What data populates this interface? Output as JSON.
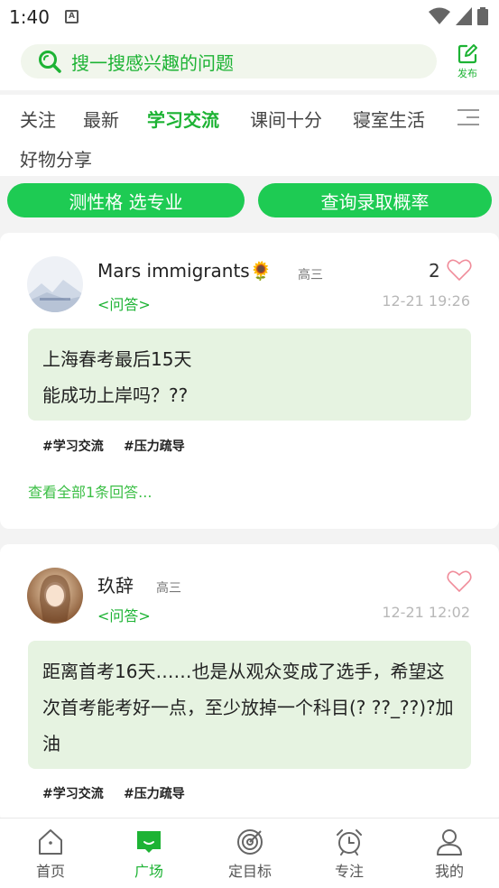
{
  "status_bar": {
    "time": "1:40",
    "notif_letter": "A"
  },
  "search": {
    "placeholder": "搜一搜感兴趣的问题",
    "publish_label": "发布"
  },
  "tabs": [
    {
      "label": "关注",
      "active": false
    },
    {
      "label": "最新",
      "active": false
    },
    {
      "label": "学习交流",
      "active": true
    },
    {
      "label": "课间十分",
      "active": false
    },
    {
      "label": "寝室生活",
      "active": false
    },
    {
      "label": "好物分享",
      "active": false
    }
  ],
  "promos": {
    "left": "测性格 选专业",
    "right": "查询录取概率"
  },
  "posts": [
    {
      "author": "Mars immigrants🌻",
      "grade": "高三",
      "type": "<问答>",
      "time": "12-21 19:26",
      "likes": "2",
      "body_line1": "上海春考最后15天",
      "body_line2": "能成功上岸吗？??",
      "tags": [
        "#学习交流",
        "#压力疏导"
      ],
      "view_all": "查看全部1条回答..."
    },
    {
      "author": "玖辞",
      "grade": "高三",
      "type": "<问答>",
      "time": "12-21 12:02",
      "likes": "",
      "body": "距离首考16天……也是从观众变成了选手，希望这次首考能考好一点，至少放掉一个科目(? ??_??)?加油",
      "tags": [
        "#学习交流",
        "#压力疏导"
      ]
    }
  ],
  "bottom_nav": [
    {
      "label": "首页",
      "icon": "home-icon",
      "active": false
    },
    {
      "label": "广场",
      "icon": "square-icon",
      "active": true
    },
    {
      "label": "定目标",
      "icon": "target-icon",
      "active": false
    },
    {
      "label": "专注",
      "icon": "alarm-icon",
      "active": false
    },
    {
      "label": "我的",
      "icon": "profile-icon",
      "active": false
    }
  ],
  "colors": {
    "accent": "#1db334",
    "promo_green": "#1ecb53",
    "post_bg": "#e6f3e1",
    "heart": "#f08c9a"
  }
}
